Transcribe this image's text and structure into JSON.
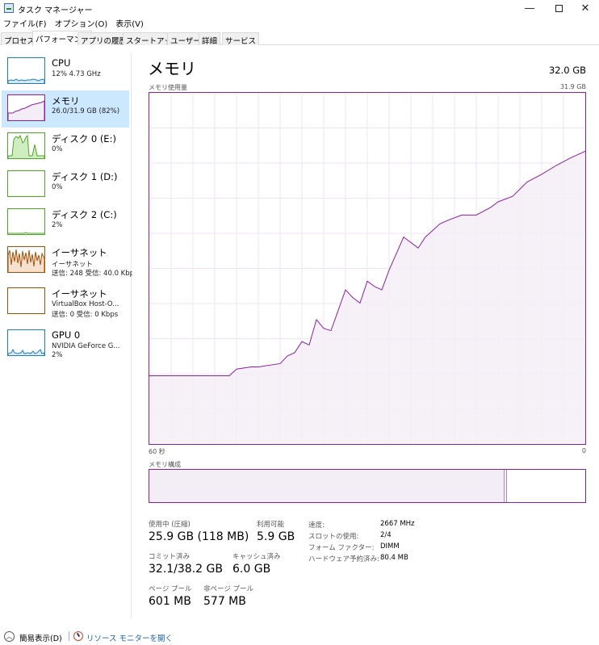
{
  "window": {
    "title": "タスク マネージャー",
    "minimize": "—",
    "close": "✕"
  },
  "menu": [
    "ファイル(F)",
    "オプション(O)",
    "表示(V)"
  ],
  "tabs": [
    "プロセス",
    "パフォーマンス",
    "アプリの履歴",
    "スタートアップ",
    "ユーザー",
    "詳細",
    "サービス"
  ],
  "active_tab": "パフォーマンス",
  "sidebar": [
    {
      "title": "CPU",
      "sub1": "12%  4.73 GHz",
      "sub2": "",
      "icon": "cpu-graph",
      "color": "#1a7dc7"
    },
    {
      "title": "メモリ",
      "sub1": "26.0/31.9 GB (82%)",
      "sub2": "",
      "icon": "memory-graph",
      "color": "#8b1fa9"
    },
    {
      "title": "ディスク 0 (E:)",
      "sub1": "0%",
      "sub2": "",
      "icon": "disk-graph",
      "color": "#4da625"
    },
    {
      "title": "ディスク 1 (D:)",
      "sub1": "0%",
      "sub2": "",
      "icon": "disk-graph",
      "color": "#4da625"
    },
    {
      "title": "ディスク 2 (C:)",
      "sub1": "2%",
      "sub2": "",
      "icon": "disk-graph",
      "color": "#4da625"
    },
    {
      "title": "イーサネット",
      "sub1": "イーサネット",
      "sub2": "送信: 248  受信: 40.0 Kbps",
      "icon": "ethernet-graph",
      "color": "#a74f01"
    },
    {
      "title": "イーサネット",
      "sub1": "VirtualBox Host-O...",
      "sub2": "送信: 0  受信: 0 Kbps",
      "icon": "ethernet-graph",
      "color": "#a74f01"
    },
    {
      "title": "GPU 0",
      "sub1": "NVIDIA GeForce G...",
      "sub2": "2%",
      "icon": "gpu-graph",
      "color": "#1a7dc7"
    }
  ],
  "main": {
    "title": "メモリ",
    "total": "32.0 GB",
    "usage_label": "メモリ使用量",
    "usage_max": "31.9 GB",
    "time_left": "60 秒",
    "time_right": "0",
    "composition_label": "メモリ構成",
    "accent": "#8b1fa9"
  },
  "chart_data": {
    "type": "area",
    "title": "メモリ使用量",
    "xlabel": "",
    "ylabel": "",
    "xlim": [
      60,
      0
    ],
    "ylim": [
      0,
      31.9
    ],
    "x": [
      60,
      57,
      55,
      53,
      51,
      49,
      48,
      46,
      45,
      42,
      41,
      40,
      39,
      38,
      37,
      36,
      35,
      33,
      32,
      31,
      30,
      29,
      28,
      27,
      25,
      24,
      23,
      22,
      20,
      19,
      17,
      16,
      15,
      13,
      12,
      10,
      8,
      6,
      4,
      2,
      0
    ],
    "values": [
      6.2,
      6.2,
      6.2,
      6.2,
      6.2,
      6.2,
      6.8,
      7.0,
      7.0,
      7.3,
      8.0,
      8.3,
      9.3,
      9.0,
      11.3,
      10.5,
      10.3,
      14.0,
      13.3,
      12.8,
      14.8,
      14.3,
      14.0,
      15.8,
      18.8,
      18.3,
      17.8,
      18.8,
      20.0,
      20.3,
      20.8,
      20.8,
      20.8,
      21.5,
      22.0,
      22.5,
      23.8,
      24.5,
      25.3,
      26.0,
      26.6
    ]
  },
  "stats": {
    "in_use_label": "使用中 (圧縮)",
    "in_use": "25.9 GB (118 MB)",
    "available_label": "利用可能",
    "available": "5.9 GB",
    "committed_label": "コミット済み",
    "committed": "32.1/38.2 GB",
    "cached_label": "キャッシュ済み",
    "cached": "6.0 GB",
    "paged_label": "ページ プール",
    "paged": "601 MB",
    "nonpaged_label": "非ページ プール",
    "nonpaged": "577 MB",
    "speed_label": "速度:",
    "speed": "2667 MHz",
    "slots_label": "スロットの使用:",
    "slots": "2/4",
    "form_label": "フォーム ファクター:",
    "form": "DIMM",
    "reserved_label": "ハードウェア予約済み:",
    "reserved": "80.4 MB"
  },
  "footer": {
    "fewer": "簡易表示(D)",
    "monitor": "リソース モニターを開く"
  }
}
